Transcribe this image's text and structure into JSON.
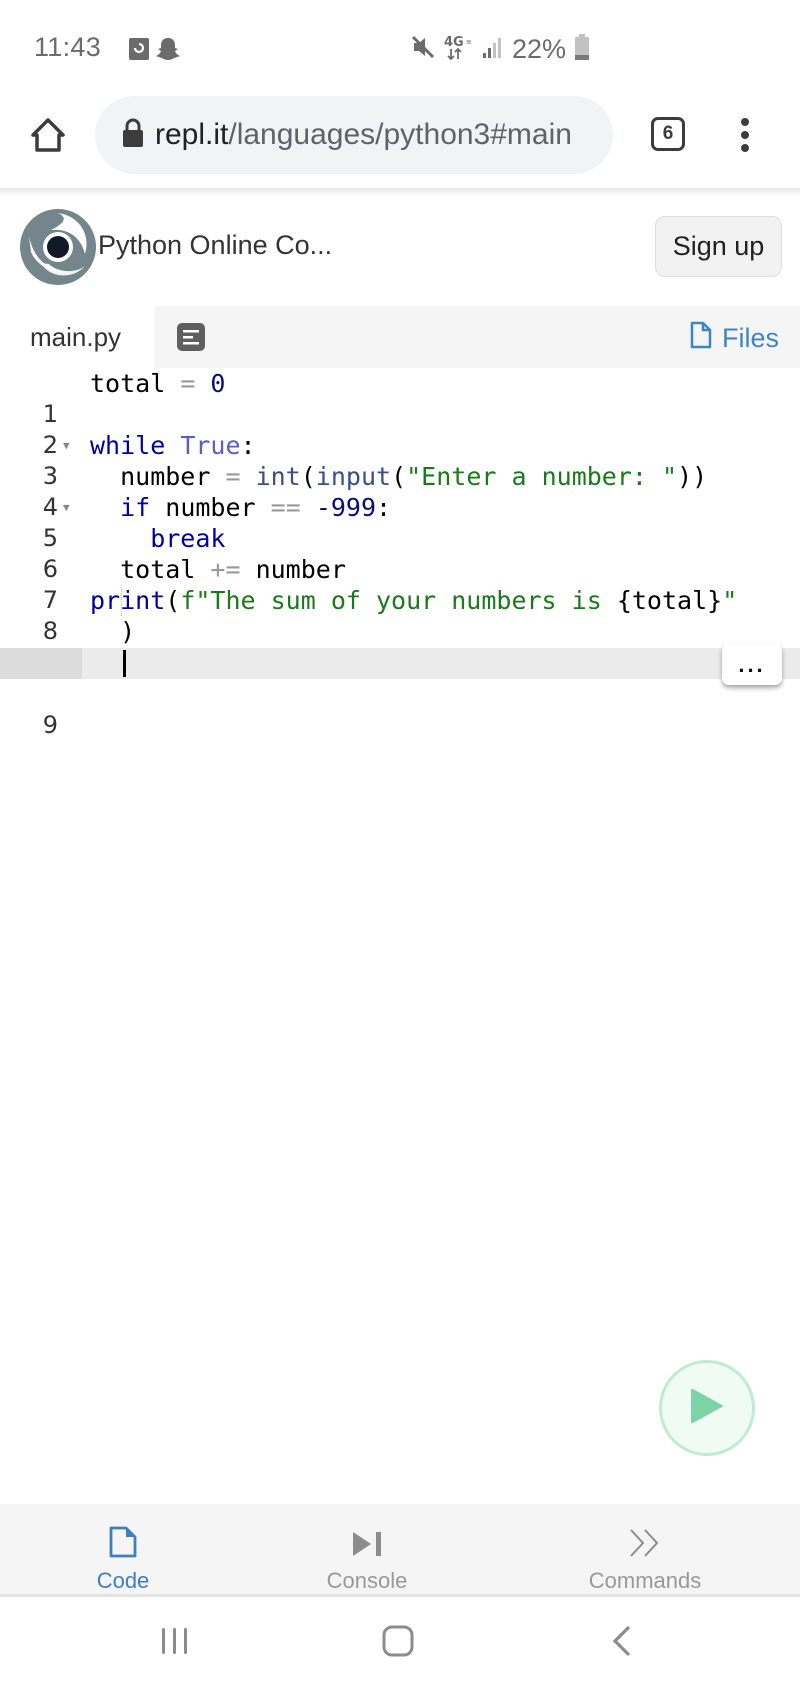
{
  "status_bar": {
    "time": "11:43",
    "notification_icons": [
      "screen-recorder-icon",
      "snapchat-icon"
    ],
    "system_icons": [
      "mute-icon",
      "4g-lte-icon",
      "signal-icon"
    ],
    "battery_percent": "22%",
    "battery_level": 0.22
  },
  "browser": {
    "url_host": "repl.it",
    "url_path": "/languages/python3#main",
    "tab_count": "6"
  },
  "header": {
    "title": "Python Online Co...",
    "signup_label": "Sign up"
  },
  "file_tabs": {
    "active_file": "main.py",
    "files_label": "Files"
  },
  "editor": {
    "lines": [
      {
        "n": "1",
        "fold": false
      },
      {
        "n": "2",
        "fold": false
      },
      {
        "n": "3",
        "fold": true
      },
      {
        "n": "4",
        "fold": false
      },
      {
        "n": "5",
        "fold": true
      },
      {
        "n": "6",
        "fold": false
      },
      {
        "n": "7",
        "fold": false
      },
      {
        "n": "8",
        "fold": false
      },
      {
        "n": "",
        "fold": false
      },
      {
        "n": "9",
        "fold": false
      }
    ],
    "code": {
      "l1_a": "total",
      "l1_op": " = ",
      "l1_num": "0",
      "l3_kw": "while",
      "l3_const": "True",
      "l3_colon": ":",
      "l4_a": "  number",
      "l4_op": " = ",
      "l4_fn1": "int",
      "l4_p1": "(",
      "l4_fn2": "input",
      "l4_p2": "(",
      "l4_str": "\"Enter a number: \"",
      "l4_p3": "))",
      "l5_kw": "  if",
      "l5_a": " number ",
      "l5_op": "==",
      "l5_sp": " ",
      "l5_num": "-999",
      "l5_colon": ":",
      "l6_kw": "    break",
      "l7_a": "  total ",
      "l7_op": "+=",
      "l7_b": " number",
      "l8_kw": "print",
      "l8_p": "(",
      "l8_str": "f\"The sum of your numbers is ",
      "l8_interp": "{total}",
      "l8_str2": "\"",
      "l8_wrap": "  )"
    },
    "more_label": "..."
  },
  "run_button": {
    "label": "Run",
    "icon": "play-icon"
  },
  "bottom_tabs": [
    {
      "label": "Code",
      "icon": "file-icon",
      "active": true
    },
    {
      "label": "Console",
      "icon": "step-forward-icon",
      "active": false
    },
    {
      "label": "Commands",
      "icon": "double-chevron-icon",
      "active": false
    }
  ],
  "colors": {
    "accent_blue": "#3d7fc1",
    "run_green": "#7dd3a8",
    "keyword": "#0000a2",
    "string": "#1a7a1a"
  }
}
